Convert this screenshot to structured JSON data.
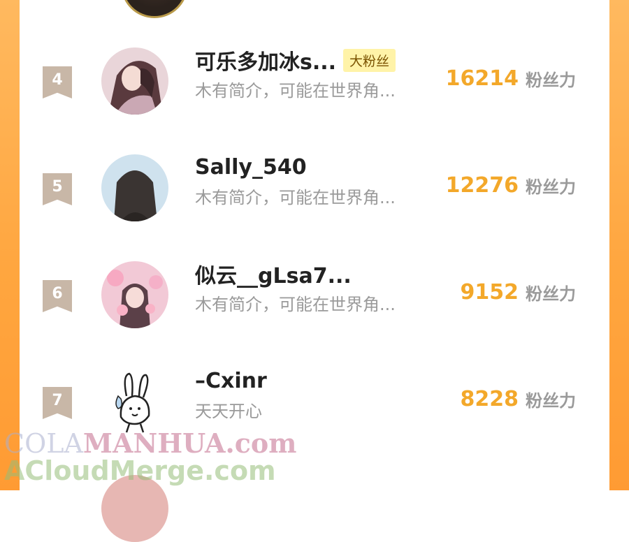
{
  "colors": {
    "accent_orange": "#f3a82a",
    "border_gradient": "#ffa63f",
    "rank_badge": "#c8b7a7",
    "muted_text": "#9a9a9a",
    "badge_bg": "#fff3a8"
  },
  "score_unit": "粉丝力",
  "rows": [
    {
      "rank": "4",
      "name": "可乐多加冰s...",
      "badge": "大粉丝",
      "bio": "木有简介，可能在世界角...",
      "score": "16214"
    },
    {
      "rank": "5",
      "name": "Sally_540",
      "bio": "木有简介，可能在世界角...",
      "score": "12276"
    },
    {
      "rank": "6",
      "name": "似云__gLsa7...",
      "bio": "木有简介，可能在世界角...",
      "score": "9152"
    },
    {
      "rank": "7",
      "name": "–Cxinr",
      "bio": "天天开心",
      "score": "8228"
    }
  ],
  "watermark": {
    "line1_a": "COLA",
    "line1_b": "MANHUA.com",
    "line2": "ACloudMerge.com"
  }
}
